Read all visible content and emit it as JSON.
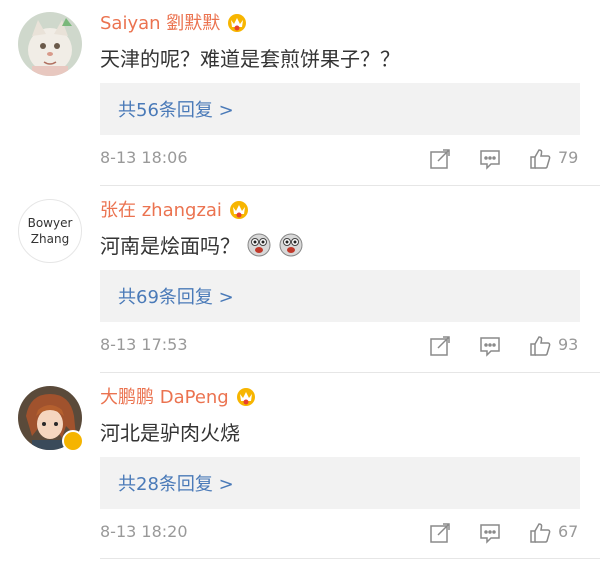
{
  "comments": [
    {
      "username": "Saiyan 劉默默",
      "avatar_icon": "cat-avatar-icon",
      "text": "天津的呢？难道是套煎饼果子？？",
      "replies": "共56条回复 >",
      "time": "8-13 18:06",
      "likes": "79"
    },
    {
      "username": "张在 zhangzai",
      "avatar_line1": "Bowyer",
      "avatar_line2": "Zhang",
      "text": "河南是烩面吗？",
      "replies": "共69条回复 >",
      "time": "8-13 17:53",
      "likes": "93"
    },
    {
      "username": "大鹏鹏 DaPeng",
      "avatar_icon": "anime-character-avatar-icon",
      "text": "河北是驴肉火烧",
      "replies": "共28条回复 >",
      "time": "8-13 18:20",
      "likes": "67"
    }
  ],
  "colors": {
    "username": "#eb7350",
    "reply_link": "#4a7ab8",
    "reply_bg": "#f2f2f2",
    "meta": "#999999",
    "text": "#333333"
  }
}
